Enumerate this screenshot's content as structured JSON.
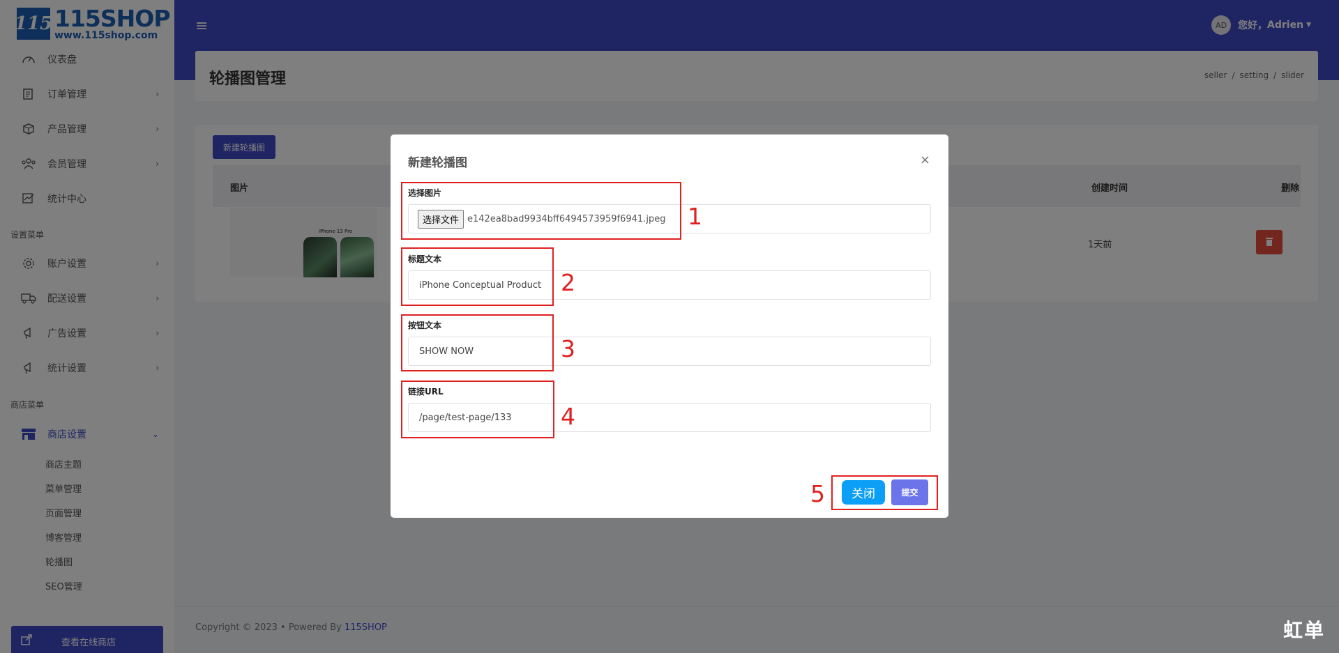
{
  "logo": {
    "title": "115SHOP",
    "subtitle": "www.115shop.com",
    "mark": "115"
  },
  "sidebar": {
    "items": [
      {
        "label": "仪表盘",
        "icon": "dashboard-icon"
      },
      {
        "label": "订单管理",
        "icon": "orders-icon"
      },
      {
        "label": "产品管理",
        "icon": "products-icon"
      },
      {
        "label": "会员管理",
        "icon": "members-icon"
      },
      {
        "label": "统计中心",
        "icon": "statistics-icon"
      }
    ],
    "section_settings": "设置菜单",
    "settings_items": [
      {
        "label": "账户设置",
        "icon": "account-icon"
      },
      {
        "label": "配送设置",
        "icon": "delivery-icon"
      },
      {
        "label": "广告设置",
        "icon": "ads-icon"
      },
      {
        "label": "统计设置",
        "icon": "stats-settings-icon"
      }
    ],
    "section_store": "商店菜单",
    "store_item": {
      "label": "商店设置",
      "icon": "store-icon"
    },
    "store_sub_items": [
      "商店主题",
      "菜单管理",
      "页面管理",
      "博客管理",
      "轮播图",
      "SEO管理"
    ],
    "view_store": "查看在线商店"
  },
  "header": {
    "avatar": "AD",
    "greeting": "您好，",
    "username": "Adrien"
  },
  "page": {
    "title": "轮播图管理",
    "breadcrumb": [
      "seller",
      "setting",
      "slider"
    ]
  },
  "card": {
    "new_button": "新建轮播图",
    "columns": {
      "image": "图片",
      "created": "创建时间",
      "delete": "删除"
    },
    "row": {
      "image_caption": "iPhone 13 Pro",
      "created": "1天前"
    }
  },
  "footer": {
    "copyright": "Copyright © 2023",
    "bullet": "•",
    "powered": "Powered By",
    "brand": "115SHOP"
  },
  "modal": {
    "title": "新建轮播图",
    "close_icon": "×",
    "fields": {
      "image_label": "选择图片",
      "file_button": "选择文件",
      "file_name": "e142ea8bad9934bff6494573959f6941.jpeg",
      "title_label": "标题文本",
      "title_value": "iPhone Conceptual Product",
      "button_label": "按钮文本",
      "button_value": "SHOW NOW",
      "url_label": "链接URL",
      "url_value": "/page/test-page/133"
    },
    "close_button": "关闭",
    "submit_button": "提交"
  },
  "annotations": [
    "1",
    "2",
    "3",
    "4",
    "5"
  ],
  "watermark": "虹单",
  "colors": {
    "primary": "#3f49c7",
    "danger": "#e74c3c",
    "close_button": "#0b9ff7",
    "submit_button": "#6c74ea",
    "annotation": "#e02020"
  }
}
